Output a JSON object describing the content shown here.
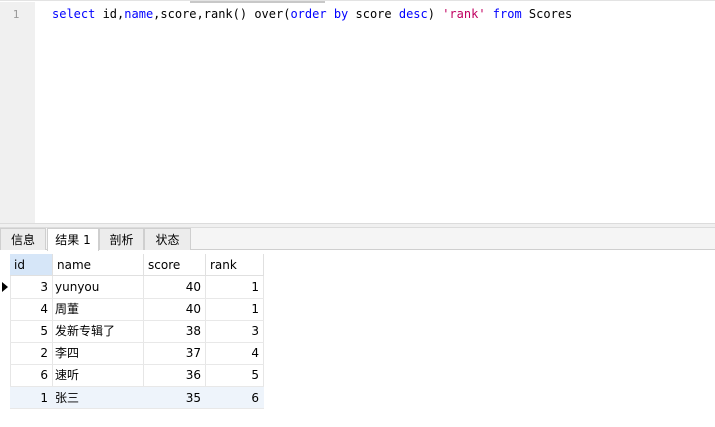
{
  "editor": {
    "line_number": "1",
    "code": {
      "t1": "select",
      "t2": " id,",
      "t3": "name",
      "t4": ",score,rank() over(",
      "t5": "order",
      "t6": " ",
      "t7": "by",
      "t8": " score ",
      "t9": "desc",
      "t10": ") ",
      "t11": "'rank'",
      "t12": " ",
      "t13": "from",
      "t14": " Scores"
    }
  },
  "tabs": [
    {
      "label": "信息"
    },
    {
      "label": "结果 1"
    },
    {
      "label": "剖析"
    },
    {
      "label": "状态"
    }
  ],
  "grid": {
    "headers": [
      "id",
      "name",
      "score",
      "rank"
    ],
    "rows": [
      {
        "id": "3",
        "name": "yunyou",
        "score": "40",
        "rank": "1"
      },
      {
        "id": "4",
        "name": "周董",
        "score": "40",
        "rank": "1"
      },
      {
        "id": "5",
        "name": "发新专辑了",
        "score": "38",
        "rank": "3"
      },
      {
        "id": "2",
        "name": "李四",
        "score": "37",
        "rank": "4"
      },
      {
        "id": "6",
        "name": "速听",
        "score": "36",
        "rank": "5"
      },
      {
        "id": "1",
        "name": "张三",
        "score": "35",
        "rank": "6"
      }
    ]
  },
  "colors": {
    "keyword": "#0000ff",
    "string": "#c00060",
    "selected_header": "#d6e6f8"
  }
}
